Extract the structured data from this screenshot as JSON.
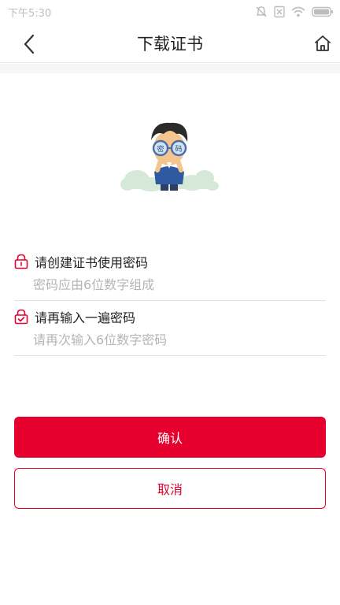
{
  "status_bar": {
    "time": "下午5:30",
    "icons": [
      "silent-icon",
      "no-sim-icon",
      "wifi-icon",
      "battery-icon"
    ]
  },
  "header": {
    "title": "下载证书",
    "back_icon": "chevron-left-icon",
    "home_icon": "home-icon"
  },
  "illustration": {
    "lens_left_text": "密",
    "lens_right_text": "码"
  },
  "form": {
    "password": {
      "label": "请创建证书使用密码",
      "placeholder": "密码应由6位数字组成",
      "value": ""
    },
    "confirm_password": {
      "label": "请再输入一遍密码",
      "placeholder": "请再次输入6位数字密码",
      "value": ""
    }
  },
  "actions": {
    "confirm_label": "确认",
    "cancel_label": "取消"
  },
  "colors": {
    "accent": "#e5002d",
    "divider": "#e3e3e3",
    "placeholder": "#b5b5b5"
  }
}
